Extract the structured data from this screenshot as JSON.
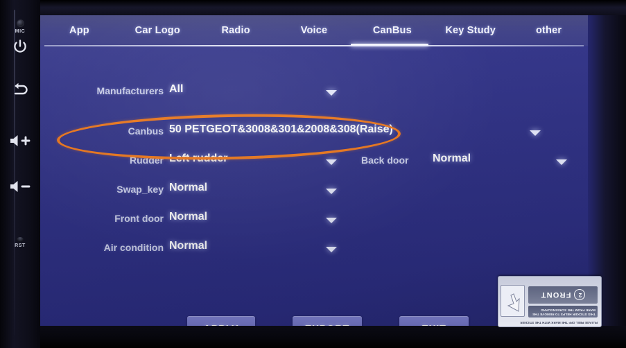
{
  "device": {
    "side_buttons": [
      {
        "name": "mic",
        "label": "MIC",
        "icon": "mic-hole-icon"
      },
      {
        "name": "power",
        "label": "",
        "icon": "power-icon"
      },
      {
        "name": "back",
        "label": "",
        "icon": "back-arrow-icon"
      },
      {
        "name": "volume-up",
        "label": "+",
        "icon": "volume-up-icon"
      },
      {
        "name": "volume-down",
        "label": "−",
        "icon": "volume-down-icon"
      },
      {
        "name": "reset",
        "label": "RST",
        "icon": "reset-hole-icon"
      }
    ]
  },
  "tabs": [
    {
      "id": "app",
      "label": "App",
      "active": false
    },
    {
      "id": "car-logo",
      "label": "Car Logo",
      "active": false
    },
    {
      "id": "radio",
      "label": "Radio",
      "active": false
    },
    {
      "id": "voice",
      "label": "Voice",
      "active": false
    },
    {
      "id": "canbus",
      "label": "CanBus",
      "active": true
    },
    {
      "id": "key-study",
      "label": "Key Study",
      "active": false
    },
    {
      "id": "other",
      "label": "other",
      "active": false
    }
  ],
  "form": {
    "rows": [
      {
        "id": "manufacturers",
        "label": "Manufacturers",
        "value": "All",
        "caret": "chevron-down-icon"
      },
      {
        "id": "canbus",
        "label": "Canbus",
        "value": "50 PETGEOT&3008&301&2008&308(Raise)",
        "caret": "chevron-down-icon"
      },
      {
        "id": "rudder",
        "label": "Rudder",
        "value": "Left rudder",
        "caret": "chevron-down-icon"
      },
      {
        "id": "swap-key",
        "label": "Swap_key",
        "value": "Normal",
        "caret": "chevron-down-icon"
      },
      {
        "id": "front-door",
        "label": "Front door",
        "value": "Normal",
        "caret": "chevron-down-icon"
      },
      {
        "id": "air-condition",
        "label": "Air condition",
        "value": "Normal",
        "caret": "chevron-down-icon"
      }
    ],
    "back_door": {
      "id": "back-door",
      "label": "Back door",
      "value": "Normal",
      "caret": "chevron-down-icon"
    }
  },
  "buttons": [
    {
      "id": "apply",
      "label": "APPLY"
    },
    {
      "id": "export",
      "label": "EXPORT"
    },
    {
      "id": "exit",
      "label": "EXIT"
    }
  ],
  "annotation": {
    "type": "ellipse-highlight",
    "target": "canbus-row",
    "color": "#f0781a"
  },
  "sticker": {
    "line1": "PLEASE PEEL OFF THE MARK WITH THE STICKER",
    "band": "THIS STICKER HELPS TO REMOVE THE MARK FROM THE SCREENGUARD",
    "front": "FRONT",
    "number": "2",
    "icon": "hand-peel-icon"
  },
  "colors": {
    "screen_bg": "#2e3086",
    "tabbar_bg": "#3c3e86",
    "text": "#ffffff",
    "label": "#cdd1ec",
    "button": "#7174c8",
    "highlight": "#f0781a"
  }
}
